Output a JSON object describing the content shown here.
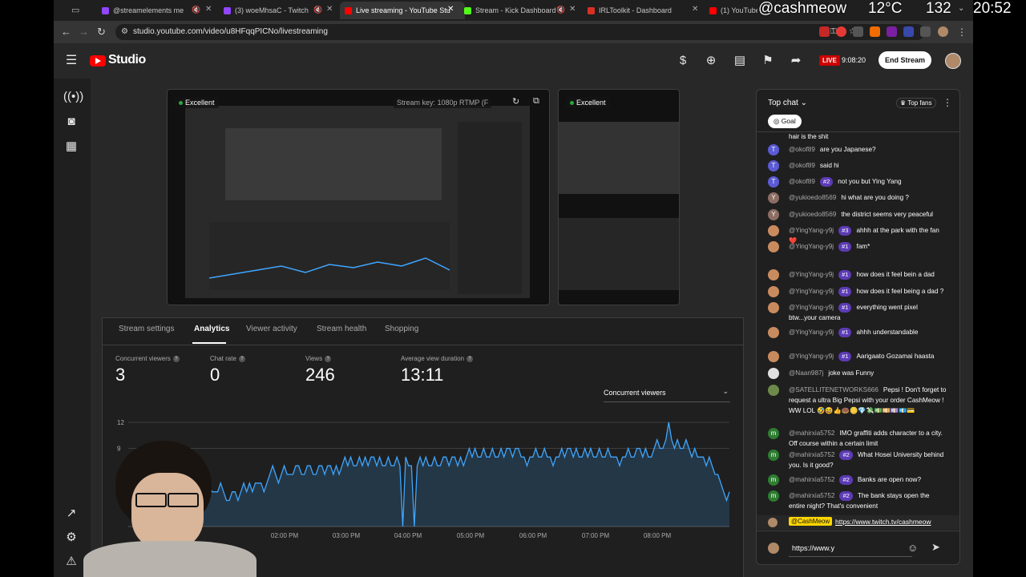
{
  "overlay": {
    "handle": "@cashmeow",
    "temperature": "12°C",
    "count": "132",
    "time": "20:52"
  },
  "browser": {
    "tabs": [
      {
        "label": "@streamelements me",
        "color": "#9146ff"
      },
      {
        "label": "(3) woeMhsaC - Twitch",
        "color": "#9146ff"
      },
      {
        "label": "Live streaming - YouTube Stu",
        "color": "#ff0000"
      },
      {
        "label": "Stream - Kick Dashboard",
        "color": "#53fc18"
      },
      {
        "label": "IRLToolkit - Dashboard",
        "color": "#d93025"
      },
      {
        "label": "(1) YouTube",
        "color": "#ff0000"
      }
    ],
    "url": "studio.youtube.com/video/u8HFqqPICNo/livestreaming"
  },
  "header": {
    "logo": "Studio",
    "live_badge": "LIVE",
    "live_timer": "9:08:20",
    "end_stream": "End Stream"
  },
  "previews": {
    "main_status": "Excellent",
    "stream_key": "Stream key: 1080p RTMP (F",
    "side_status": "Excellent"
  },
  "main_tabs": [
    "Stream settings",
    "Analytics",
    "Viewer activity",
    "Stream health",
    "Shopping"
  ],
  "metrics": [
    {
      "label": "Concurrent viewers",
      "value": "3"
    },
    {
      "label": "Chat rate",
      "value": "0"
    },
    {
      "label": "Views",
      "value": "246"
    },
    {
      "label": "Average view duration",
      "value": "13:11"
    }
  ],
  "chart_selector": "Concurrent viewers",
  "chart_data": {
    "type": "area",
    "title": "",
    "xlabel": "",
    "ylabel": "",
    "x_ticks": [
      "02:00 PM",
      "03:00 PM",
      "04:00 PM",
      "05:00 PM",
      "06:00 PM",
      "07:00 PM",
      "08:00 PM"
    ],
    "y_ticks": [
      12,
      9
    ],
    "ylim": [
      0,
      12
    ],
    "grid": true,
    "series": [
      {
        "values": [
          5,
          6,
          5,
          5,
          4,
          4,
          4,
          5,
          4,
          3,
          3,
          4,
          4,
          3,
          4,
          5,
          4,
          5,
          4,
          5,
          5,
          5,
          4,
          5,
          6,
          7,
          6,
          5,
          6,
          7,
          6,
          6,
          6,
          7,
          7,
          6,
          6,
          7,
          7,
          6,
          6,
          7,
          7,
          6,
          7,
          7,
          6,
          7,
          6,
          7,
          8,
          7,
          8,
          7,
          7,
          8,
          7,
          8,
          7,
          8,
          8,
          7,
          8,
          7,
          7,
          8,
          7,
          7,
          8,
          7,
          0,
          8,
          7,
          7,
          0,
          7,
          8,
          7,
          8,
          7,
          7,
          8,
          7,
          7,
          8,
          8,
          7,
          8,
          8,
          7,
          8,
          7,
          8,
          9,
          8,
          9,
          8,
          8,
          9,
          8,
          8,
          9,
          8,
          8,
          9,
          8,
          9,
          9,
          8,
          9,
          9,
          8,
          8,
          7,
          8,
          8,
          9,
          8,
          8,
          9,
          8,
          8,
          7,
          8,
          8,
          9,
          8,
          9,
          9,
          8,
          9,
          8,
          8,
          9,
          8,
          9,
          8,
          8,
          9,
          8,
          8,
          9,
          8,
          8,
          8,
          7,
          8,
          8,
          9,
          8,
          8,
          9,
          9,
          8,
          9,
          8,
          8,
          9,
          10,
          9,
          9,
          10,
          12,
          10,
          9,
          10,
          9,
          9,
          10,
          9,
          8,
          9,
          8,
          8,
          8,
          7,
          8,
          7,
          6,
          6,
          5,
          4,
          3,
          4
        ]
      }
    ]
  },
  "chat": {
    "mode": "Top chat",
    "top_fans": "Top fans",
    "goal": "Goal",
    "truncated_top": "hair is the shit",
    "messages": [
      {
        "author": "@okof89",
        "text": "are you Japanese?",
        "badge": "",
        "avatar": "T",
        "color": "#5b5bd6"
      },
      {
        "author": "@okof89",
        "text": "said hi",
        "badge": "",
        "avatar": "T",
        "color": "#5b5bd6"
      },
      {
        "author": "@okof89",
        "text": "not you but Ying Yang",
        "badge": "#2",
        "avatar": "T",
        "color": "#5b5bd6"
      },
      {
        "author": "@yukioedo8569",
        "text": "hi what are you doing ?",
        "badge": "",
        "avatar": "Y",
        "color": "#8d6e63"
      },
      {
        "author": "@yukioedo8569",
        "text": "the district seems very peaceful",
        "badge": "",
        "avatar": "Y",
        "color": "#8d6e63"
      },
      {
        "author": "@YingYang-y9j",
        "text": "ahhh at the park with the fan ❤️",
        "badge": "#3",
        "avatar": "",
        "color": "#c98b5e"
      },
      {
        "author": "@YingYang-y9j",
        "text": "fam*",
        "badge": "#1",
        "avatar": "",
        "color": "#c98b5e"
      },
      {
        "author": "@YingYang-y9j",
        "text": "how does it feel bein a dad",
        "badge": "#1",
        "avatar": "",
        "color": "#c98b5e"
      },
      {
        "author": "@YingYang-y9j",
        "text": "how does it feel being a dad ?",
        "badge": "#1",
        "avatar": "",
        "color": "#c98b5e"
      },
      {
        "author": "@YingYang-y9j",
        "text": "everything went pixel btw...your camera",
        "badge": "#1",
        "avatar": "",
        "color": "#c98b5e"
      },
      {
        "author": "@YingYang-y9j",
        "text": "ahhh understandable",
        "badge": "#1",
        "avatar": "",
        "color": "#c98b5e"
      },
      {
        "author": "@YingYang-y9j",
        "text": "Aarigaato Gozamai haasta",
        "badge": "#1",
        "avatar": "",
        "color": "#c98b5e"
      },
      {
        "author": "@Naan987j",
        "text": "joke was Funny",
        "badge": "",
        "avatar": "",
        "color": "#e0e0e0"
      },
      {
        "author": "@SATELLITENETWORKS666",
        "text": "Pepsi ! Don't forget to request a ultra Big Pepsi with your order CashMeow ! WW LOL 🤣😆👍🍩🪙💎💸💵💴💷💶💳",
        "badge": "",
        "avatar": "",
        "color": "#6d8a4a"
      },
      {
        "author": "@mahirxia5752",
        "text": "IMO graffiti adds character to a city. Off course within a certain limit",
        "badge": "",
        "avatar": "m",
        "color": "#2e7d32"
      },
      {
        "author": "@mahirxia5752",
        "text": "What Hosei University behind you. Is it good?",
        "badge": "#2",
        "avatar": "m",
        "color": "#2e7d32"
      },
      {
        "author": "@mahirxia5752",
        "text": "Banks are open now?",
        "badge": "#2",
        "avatar": "m",
        "color": "#2e7d32"
      },
      {
        "author": "@mahirxia5752",
        "text": "The bank stays open the entire night? That's convenient",
        "badge": "#2",
        "avatar": "m",
        "color": "#2e7d32"
      }
    ],
    "pinned_author": "@CashMeow",
    "pinned_link": "https://www.twitch.tv/cashmeow",
    "input_value": "https://www.y"
  }
}
